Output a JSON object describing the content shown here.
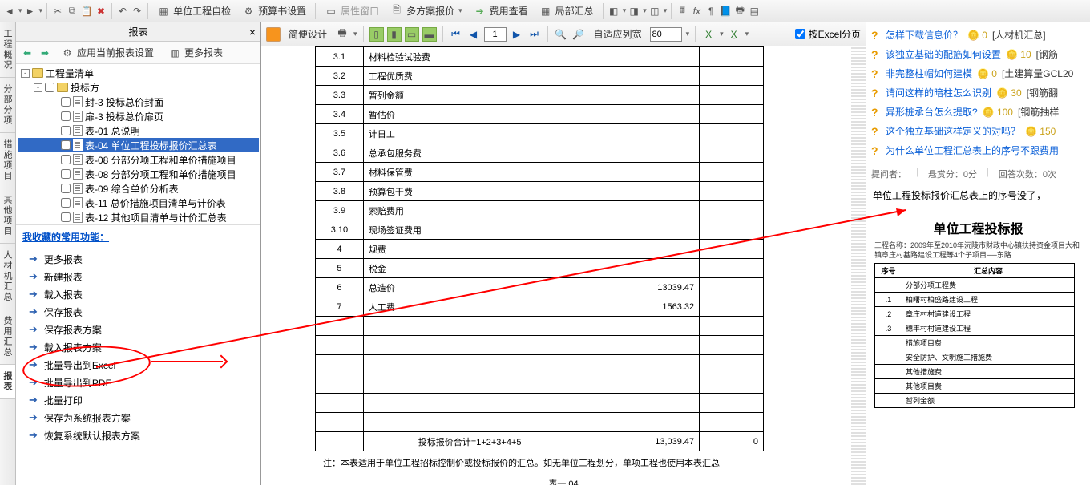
{
  "top_toolbar": {
    "self_check": "单位工程自检",
    "budget_set": "预算书设置",
    "prop_win": "属性窗口",
    "multi_quote": "多方案报价",
    "fee_view": "费用查看",
    "local_sum": "局部汇总"
  },
  "left": {
    "title": "报表",
    "apply_current": "应用当前报表设置",
    "more_reports": "更多报表",
    "tree": {
      "root": "工程量清单",
      "bid": "投标方",
      "items": [
        "封-3 投标总价封面",
        "扉-3 投标总价扉页",
        "表-01 总说明",
        "表-04 单位工程投标报价汇总表",
        "表-08 分部分项工程和单价措施项目",
        "表-08 分部分项工程和单价措施项目",
        "表-09 综合单价分析表",
        "表-11 总价措施项目清单与计价表",
        "表-12 其他项目清单与计价汇总表"
      ],
      "selected_index": 3
    },
    "fav_title": "我收藏的常用功能：",
    "fav": [
      "更多报表",
      "新建报表",
      "载入报表",
      "保存报表",
      "保存报表方案",
      "载入报表方案",
      "批量导出到Excel",
      "批量导出到PDF",
      "批量打印",
      "保存为系统报表方案",
      "恢复系统默认报表方案"
    ]
  },
  "vtabs": [
    "工程概况",
    "分部分项",
    "措施项目",
    "其他项目",
    "人材机汇总",
    "费用汇总",
    "报表"
  ],
  "vtab_active": 6,
  "center_tb": {
    "design": "简便设计",
    "page_num": "1",
    "fit": "自适应列宽",
    "zoom": "80",
    "excel_page": "按Excel分页"
  },
  "report_rows": [
    {
      "no": "3.1",
      "name": "材料检验试验费",
      "v": "",
      "p": ""
    },
    {
      "no": "3.2",
      "name": "工程优质费",
      "v": "",
      "p": ""
    },
    {
      "no": "3.3",
      "name": "暂列金额",
      "v": "",
      "p": ""
    },
    {
      "no": "3.4",
      "name": "暂估价",
      "v": "",
      "p": ""
    },
    {
      "no": "3.5",
      "name": "计日工",
      "v": "",
      "p": ""
    },
    {
      "no": "3.6",
      "name": "总承包服务费",
      "v": "",
      "p": ""
    },
    {
      "no": "3.7",
      "name": "材料保管费",
      "v": "",
      "p": ""
    },
    {
      "no": "3.8",
      "name": "预算包干费",
      "v": "",
      "p": ""
    },
    {
      "no": "3.9",
      "name": "索赔费用",
      "v": "",
      "p": ""
    },
    {
      "no": "3.10",
      "name": "现场签证费用",
      "v": "",
      "p": ""
    },
    {
      "no": "4",
      "name": "规费",
      "v": "",
      "p": ""
    },
    {
      "no": "5",
      "name": "税金",
      "v": "",
      "p": ""
    },
    {
      "no": "6",
      "name": "总造价",
      "v": "13039.47",
      "p": ""
    },
    {
      "no": "7",
      "name": "人工费",
      "v": "1563.32",
      "p": ""
    }
  ],
  "report_blank_rows": 6,
  "report_total": {
    "label": "投标报价合计=1+2+3+4+5",
    "v": "13,039.47",
    "p": "0"
  },
  "report_note": "注：本表适用于单位工程招标控制价或投标报价的汇总。如无单位工程划分，单项工程也使用本表汇总",
  "report_tag": "表一 04",
  "qa": [
    {
      "t": "怎样下载信息价？",
      "c": 0,
      "cat": "[人材机汇总]"
    },
    {
      "t": "该独立基础的配筋如何设置",
      "c": 10,
      "cat": "[钢筋"
    },
    {
      "t": "非完整柱帽如何建模",
      "c": 0,
      "cat": "[土建算量GCL20"
    },
    {
      "t": "请问这样的暗柱怎么识别",
      "c": 30,
      "cat": "[钢筋翻"
    },
    {
      "t": "异形桩承台怎么提取?",
      "c": 100,
      "cat": "[钢筋抽样"
    },
    {
      "t": "这个独立基础这样定义的对吗？",
      "c": 150,
      "cat": ""
    },
    {
      "t": "为什么单位工程汇总表上的序号不跟费用",
      "c": null,
      "cat": ""
    }
  ],
  "qa_meta": {
    "asker": "提问者：",
    "bounty": "悬赏分：0分",
    "answers": "回答次数：0次"
  },
  "qa_body": "单位工程投标报价汇总表上的序号没了，",
  "rp_preview": {
    "title": "单位工程投标报",
    "sub": "工程名称：2009年至2010年沅陵市财政中心镇扶持资金项目大和镇章庄村基路建设工程等4个子项目──东路",
    "th1": "序号",
    "th2": "汇总内容",
    "rows": [
      {
        "n": "",
        "t": "分部分项工程费"
      },
      {
        "n": ".1",
        "t": "柏曙村柏盛路建设工程"
      },
      {
        "n": ".2",
        "t": "章庄村村道建设工程"
      },
      {
        "n": ".3",
        "t": "穗丰村村道建设工程"
      },
      {
        "n": "",
        "t": "措施项目费"
      },
      {
        "n": "",
        "t": "安全防护、文明施工措施费"
      },
      {
        "n": "",
        "t": "其他措施费"
      },
      {
        "n": "",
        "t": "其他项目费"
      },
      {
        "n": "",
        "t": "暂列金额"
      }
    ]
  }
}
